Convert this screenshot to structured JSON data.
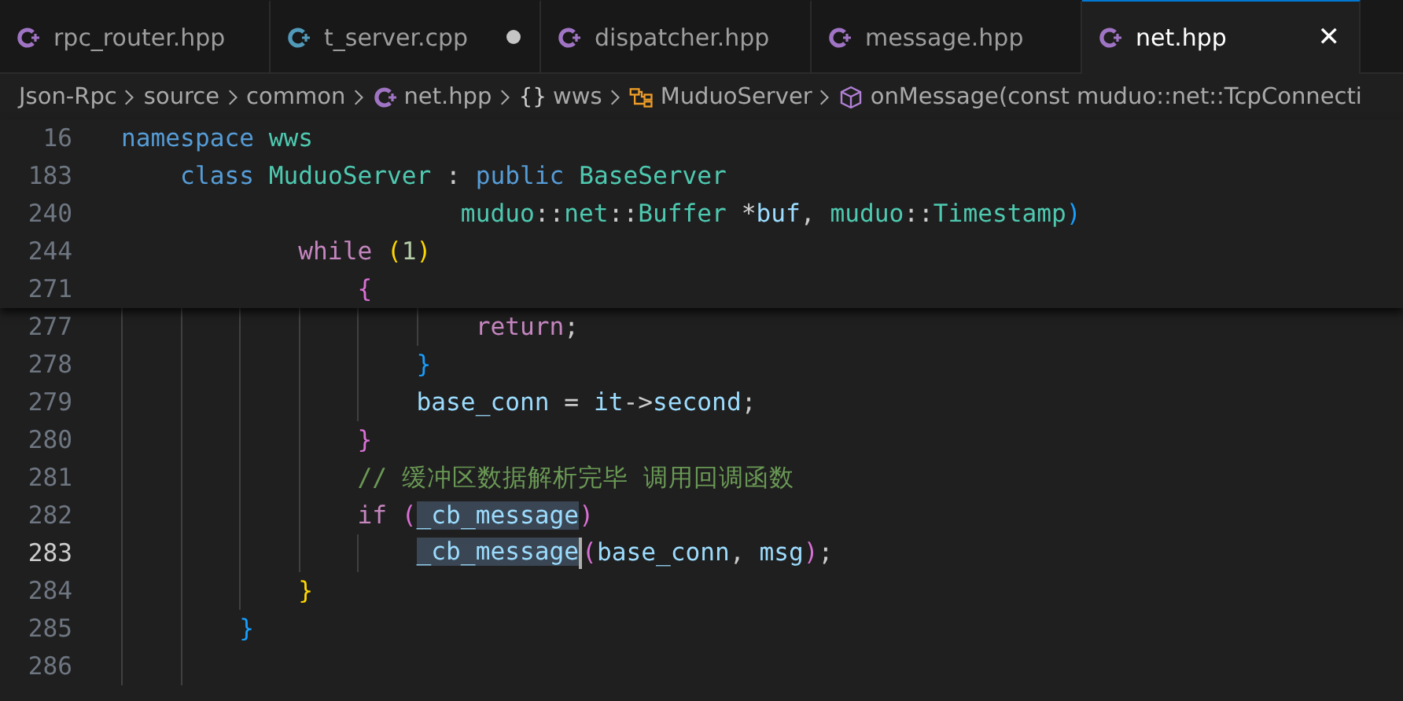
{
  "tabs": [
    {
      "label": "rpc_router.hpp",
      "kind": "hpp",
      "selected": false,
      "modified": false
    },
    {
      "label": "t_server.cpp",
      "kind": "cpp",
      "selected": false,
      "modified": true
    },
    {
      "label": "dispatcher.hpp",
      "kind": "hpp",
      "selected": false,
      "modified": false
    },
    {
      "label": "message.hpp",
      "kind": "hpp",
      "selected": false,
      "modified": false
    },
    {
      "label": "net.hpp",
      "kind": "hpp",
      "selected": true,
      "modified": false,
      "close": "✕"
    }
  ],
  "breadcrumb": [
    {
      "kind": "folder",
      "label": "Json-Rpc"
    },
    {
      "kind": "folder",
      "label": "source"
    },
    {
      "kind": "folder",
      "label": "common"
    },
    {
      "kind": "file",
      "label": "net.hpp"
    },
    {
      "kind": "namespace",
      "icon_text": "{}",
      "label": "wws"
    },
    {
      "kind": "class",
      "label": "MuduoServer"
    },
    {
      "kind": "method",
      "label": "onMessage(const muduo::net::TcpConnecti"
    }
  ],
  "sticky_lines": [
    {
      "number": "16",
      "tokens": [
        {
          "kind": "keyword",
          "text": "namespace "
        },
        {
          "kind": "type",
          "text": "wws"
        }
      ]
    },
    {
      "number": "183",
      "tokens": [
        {
          "kind": "keyword",
          "text": "    class "
        },
        {
          "kind": "type",
          "text": "MuduoServer"
        },
        {
          "kind": "plain",
          "text": " : "
        },
        {
          "kind": "keyword",
          "text": "public "
        },
        {
          "kind": "type",
          "text": "BaseServer"
        }
      ]
    },
    {
      "number": "240",
      "tokens": [
        {
          "kind": "type",
          "text": "                       muduo"
        },
        {
          "kind": "plain",
          "text": "::"
        },
        {
          "kind": "type",
          "text": "net"
        },
        {
          "kind": "plain",
          "text": "::"
        },
        {
          "kind": "type",
          "text": "Buffer"
        },
        {
          "kind": "operator",
          "text": " *"
        },
        {
          "kind": "param",
          "text": "buf"
        },
        {
          "kind": "plain",
          "text": ", "
        },
        {
          "kind": "type",
          "text": "muduo"
        },
        {
          "kind": "plain",
          "text": "::"
        },
        {
          "kind": "type",
          "text": "Timestamp"
        },
        {
          "kind": "bracket3",
          "text": ")"
        }
      ]
    },
    {
      "number": "244",
      "tokens": [
        {
          "kind": "control",
          "text": "            while "
        },
        {
          "kind": "bracket1",
          "text": "("
        },
        {
          "kind": "number",
          "text": "1"
        },
        {
          "kind": "bracket1",
          "text": ")"
        }
      ]
    },
    {
      "number": "271",
      "tokens": [
        {
          "kind": "bracket2",
          "text": "                {"
        }
      ]
    }
  ],
  "lines": [
    {
      "number": "277",
      "current": false,
      "guides": [
        true,
        true,
        true,
        true,
        true,
        true
      ],
      "tokens": [
        {
          "kind": "control",
          "text": "                        return"
        },
        {
          "kind": "plain",
          "text": ";"
        }
      ]
    },
    {
      "number": "278",
      "current": false,
      "guides": [
        true,
        true,
        true,
        true,
        true
      ],
      "tokens": [
        {
          "kind": "bracket3",
          "text": "                    }"
        }
      ]
    },
    {
      "number": "279",
      "current": false,
      "guides": [
        true,
        true,
        true,
        true,
        true
      ],
      "tokens": [
        {
          "kind": "variable",
          "text": "                    base_conn"
        },
        {
          "kind": "plain",
          "text": " = "
        },
        {
          "kind": "variable",
          "text": "it"
        },
        {
          "kind": "plain",
          "text": "->"
        },
        {
          "kind": "variable",
          "text": "second"
        },
        {
          "kind": "plain",
          "text": ";"
        }
      ]
    },
    {
      "number": "280",
      "current": false,
      "guides": [
        true,
        true,
        true,
        true
      ],
      "tokens": [
        {
          "kind": "bracket2",
          "text": "                }"
        }
      ]
    },
    {
      "number": "281",
      "current": false,
      "guides": [
        true,
        true,
        true,
        true
      ],
      "tokens": [
        {
          "kind": "comment",
          "text": "                // 缓冲区数据解析完毕 调用回调函数"
        }
      ]
    },
    {
      "number": "282",
      "current": false,
      "guides": [
        true,
        true,
        true,
        true
      ],
      "tokens": [
        {
          "kind": "control",
          "text": "                if "
        },
        {
          "kind": "bracket2",
          "text": "("
        },
        {
          "kind": "variable",
          "text": "_cb_message",
          "highlighted": true
        },
        {
          "kind": "bracket2",
          "text": ")"
        }
      ]
    },
    {
      "number": "283",
      "current": true,
      "guides": [
        true,
        true,
        true,
        true,
        true
      ],
      "tokens": [
        {
          "kind": "variable",
          "text": "                    _cb_message",
          "highlighted": true,
          "caret": true
        },
        {
          "kind": "bracket2",
          "text": "("
        },
        {
          "kind": "variable",
          "text": "base_conn"
        },
        {
          "kind": "plain",
          "text": ", "
        },
        {
          "kind": "variable",
          "text": "msg"
        },
        {
          "kind": "bracket2",
          "text": ")"
        },
        {
          "kind": "plain",
          "text": ";"
        }
      ]
    },
    {
      "number": "284",
      "current": false,
      "guides": [
        true,
        true,
        true
      ],
      "tokens": [
        {
          "kind": "bracket1",
          "text": "            }"
        }
      ]
    },
    {
      "number": "285",
      "current": false,
      "guides": [
        true,
        true
      ],
      "tokens": [
        {
          "kind": "bracket3",
          "text": "        }"
        }
      ]
    },
    {
      "number": "286",
      "current": false,
      "guides": [
        true,
        true
      ]
    }
  ]
}
